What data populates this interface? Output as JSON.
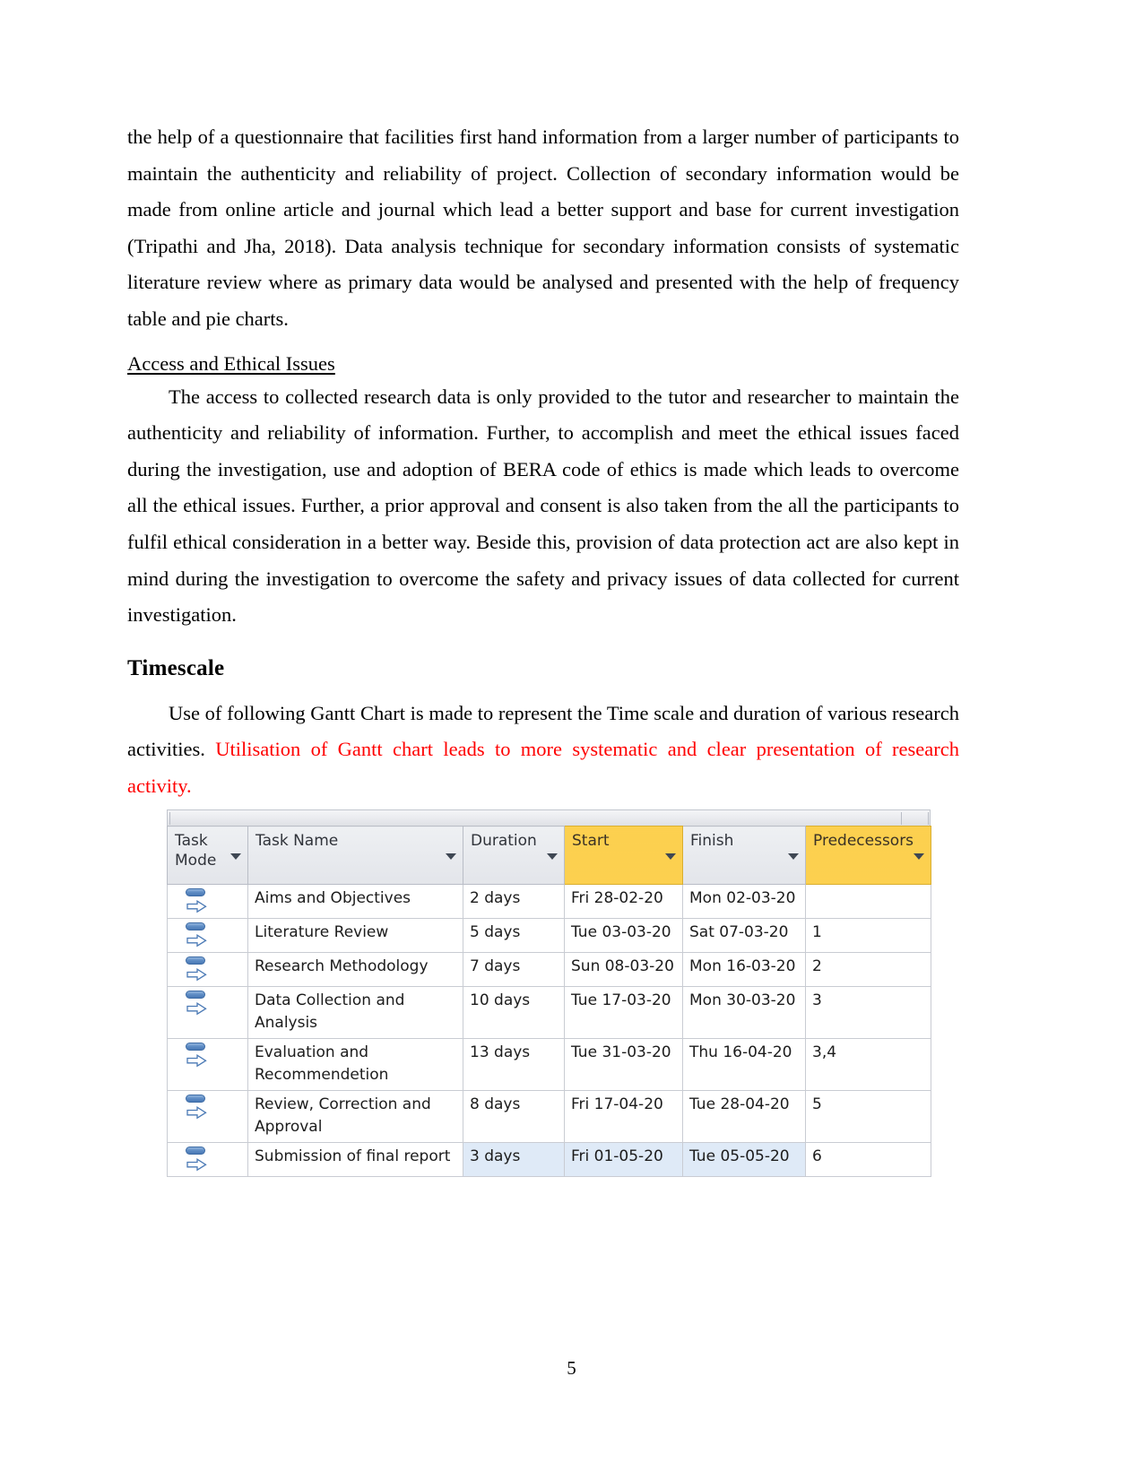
{
  "document": {
    "page_number": "5",
    "paragraph_1": "the help of a questionnaire that facilities first hand information from a larger number of participants to maintain the authenticity and reliability of project. Collection of secondary information would be made from online article and journal which lead a better support and base for current investigation (Tripathi and Jha,  2018). Data analysis technique for secondary information consists of systematic literature review where as primary data would be analysed and presented with the help of frequency table and pie charts.",
    "heading_access": "Access and Ethical Issues",
    "paragraph_2": "The access to collected research data is only provided to the tutor and researcher to maintain the authenticity and reliability of information. Further, to accomplish and meet the ethical issues faced during the investigation, use and adoption of BERA code of ethics is made which leads to overcome all the ethical issues. Further, a prior approval and consent is also taken from the all the participants to fulfil ethical consideration in a better way. Beside this, provision of data protection act are also kept in mind during the investigation to overcome the safety and privacy issues of data collected for current investigation.",
    "heading_timescale": "Timescale",
    "paragraph_3_black": "Use of following Gantt Chart is made to represent the Time scale and duration of various research activities. ",
    "paragraph_3_red": "Utilisation of Gantt chart leads to more systematic and clear presentation of research activity.",
    "red_color": "#ff0000"
  },
  "gantt_table": {
    "header_highlight_color": "#fcd04f",
    "row_selection_color": "#dfeaf7",
    "columns": [
      {
        "label": "Task Mode",
        "highlighted": false
      },
      {
        "label": "Task Name",
        "highlighted": false
      },
      {
        "label": "Duration",
        "highlighted": false
      },
      {
        "label": "Start",
        "highlighted": true
      },
      {
        "label": "Finish",
        "highlighted": false
      },
      {
        "label": "Predecessors",
        "highlighted": true
      }
    ],
    "rows": [
      {
        "task_mode_icon": "manually-scheduled-task-icon",
        "task_name": "Aims and Objectives",
        "duration": "2 days",
        "start": "Fri 28-02-20",
        "finish": "Mon 02-03-20",
        "predecessors": "",
        "selected": false
      },
      {
        "task_mode_icon": "manually-scheduled-task-icon",
        "task_name": "Literature Review",
        "duration": "5 days",
        "start": "Tue 03-03-20",
        "finish": "Sat 07-03-20",
        "predecessors": "1",
        "selected": false
      },
      {
        "task_mode_icon": "manually-scheduled-task-icon",
        "task_name": "Research Methodology",
        "duration": "7 days",
        "start": "Sun 08-03-20",
        "finish": "Mon 16-03-20",
        "predecessors": "2",
        "selected": false
      },
      {
        "task_mode_icon": "manually-scheduled-task-icon",
        "task_name": "Data Collection and Analysis",
        "duration": "10 days",
        "start": "Tue 17-03-20",
        "finish": "Mon 30-03-20",
        "predecessors": "3",
        "selected": false
      },
      {
        "task_mode_icon": "manually-scheduled-task-icon",
        "task_name": "Evaluation and Recommendetion",
        "duration": "13 days",
        "start": "Tue 31-03-20",
        "finish": "Thu 16-04-20",
        "predecessors": "3,4",
        "selected": false
      },
      {
        "task_mode_icon": "manually-scheduled-task-icon",
        "task_name": "Review, Correction and Approval",
        "duration": "8 days",
        "start": "Fri 17-04-20",
        "finish": "Tue 28-04-20",
        "predecessors": "5",
        "selected": false
      },
      {
        "task_mode_icon": "manually-scheduled-task-icon",
        "task_name": "Submission of final report",
        "duration": "3 days",
        "start": "Fri 01-05-20",
        "finish": "Tue 05-05-20",
        "predecessors": "6",
        "selected": true
      }
    ]
  }
}
